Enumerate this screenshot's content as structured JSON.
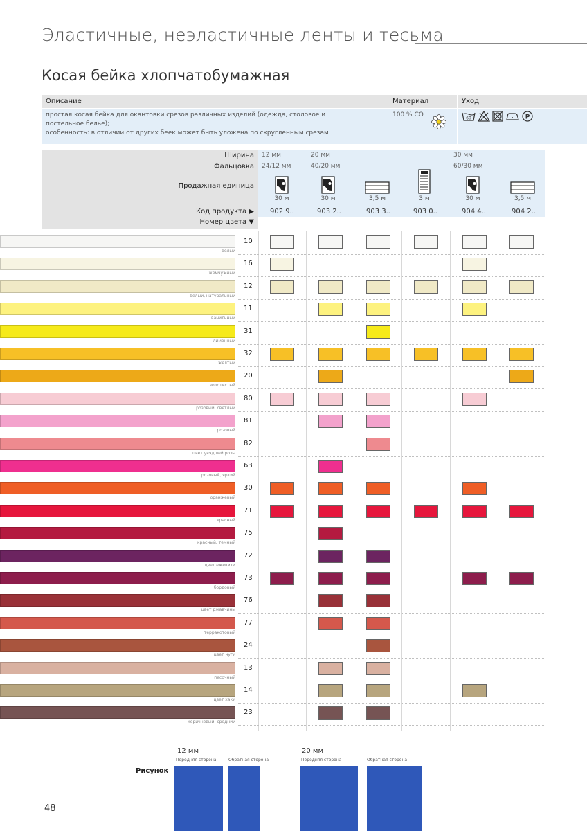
{
  "page": {
    "title": "Эластичные, неэластичные ленты и тесьма",
    "section": "Косая бейка хлопчатобумажная",
    "page_number": "48"
  },
  "info": {
    "desc_header": "Описание",
    "material_header": "Материал",
    "care_header": "Уход",
    "description_lines": [
      "простая косая бейка для окантовки срезов различных изделий (одежда, столовое и",
      "постельное белье);",
      "особенность: в отличии от других беек может быть уложена по скругленным срезам"
    ],
    "material": "100 % СО",
    "material_icon": "daisy-icon",
    "care_icons": [
      "wash-60-icon",
      "no-bleach-icon",
      "tumble-dry-icon",
      "iron-icon",
      "dry-clean-p-icon"
    ]
  },
  "spec": {
    "width_label": "Ширина",
    "fold_label": "Фальцовка",
    "unit_label": "Продажная единица",
    "code_label": "Код продукта ▶",
    "color_label": "Номер цвета ▼",
    "widths": [
      "12 мм",
      "20 мм",
      "30 мм"
    ],
    "folds": [
      "24/12 мм",
      "40/20 мм",
      "60/30 мм"
    ],
    "products": [
      {
        "unit_icon": "roll-icon",
        "length": "30 м",
        "code": "902 9.."
      },
      {
        "unit_icon": "roll-icon",
        "length": "30 м",
        "code": "903 2.."
      },
      {
        "unit_icon": "card-icon",
        "length": "3,5 м",
        "code": "903 3.."
      },
      {
        "unit_icon": "pack-icon",
        "length": "3 м",
        "code": "903 0.."
      },
      {
        "unit_icon": "roll-icon",
        "length": "30 м",
        "code": "904 4.."
      },
      {
        "unit_icon": "card-icon",
        "length": "3,5 м",
        "code": "904 2.."
      }
    ]
  },
  "colors": [
    {
      "num": "10",
      "name": "белый",
      "hex": "#f6f6f4",
      "avail": [
        1,
        1,
        1,
        1,
        1,
        1
      ]
    },
    {
      "num": "16",
      "name": "жемчужный",
      "hex": "#f7f4e2",
      "avail": [
        1,
        0,
        0,
        0,
        1,
        0
      ]
    },
    {
      "num": "12",
      "name": "белый, натуральный",
      "hex": "#f0e9c6",
      "avail": [
        1,
        1,
        1,
        1,
        1,
        1
      ]
    },
    {
      "num": "11",
      "name": "ванильный",
      "hex": "#fdf27f",
      "avail": [
        0,
        1,
        1,
        0,
        1,
        0
      ]
    },
    {
      "num": "31",
      "name": "лимонный",
      "hex": "#f6ea1a",
      "avail": [
        0,
        0,
        1,
        0,
        0,
        0
      ]
    },
    {
      "num": "32",
      "name": "желтый",
      "hex": "#f7c026",
      "avail": [
        1,
        1,
        1,
        1,
        1,
        1
      ]
    },
    {
      "num": "20",
      "name": "золотистый",
      "hex": "#eda918",
      "avail": [
        0,
        1,
        0,
        0,
        0,
        1
      ]
    },
    {
      "num": "80",
      "name": "розовый, светлый",
      "hex": "#f7ccd4",
      "avail": [
        1,
        1,
        1,
        0,
        1,
        0
      ]
    },
    {
      "num": "81",
      "name": "розовый",
      "hex": "#f3a2cc",
      "avail": [
        0,
        1,
        1,
        0,
        0,
        0
      ]
    },
    {
      "num": "82",
      "name": "цвет увядшей розы",
      "hex": "#ee8a8f",
      "avail": [
        0,
        0,
        1,
        0,
        0,
        0
      ]
    },
    {
      "num": "63",
      "name": "розовый, яркий",
      "hex": "#ef2f8f",
      "avail": [
        0,
        1,
        0,
        0,
        0,
        0
      ]
    },
    {
      "num": "30",
      "name": "оранжевый",
      "hex": "#ef5e26",
      "avail": [
        1,
        1,
        1,
        0,
        1,
        0
      ]
    },
    {
      "num": "71",
      "name": "красный",
      "hex": "#e6163c",
      "avail": [
        1,
        1,
        1,
        1,
        1,
        1
      ]
    },
    {
      "num": "75",
      "name": "красный, темный",
      "hex": "#b41a40",
      "avail": [
        0,
        1,
        0,
        0,
        0,
        0
      ]
    },
    {
      "num": "72",
      "name": "цвет ежевики",
      "hex": "#6c2460",
      "avail": [
        0,
        1,
        1,
        0,
        0,
        0
      ]
    },
    {
      "num": "73",
      "name": "бордовый",
      "hex": "#8d1d4c",
      "avail": [
        1,
        1,
        1,
        0,
        1,
        1
      ]
    },
    {
      "num": "76",
      "name": "цвет ржавчины",
      "hex": "#993138",
      "avail": [
        0,
        1,
        1,
        0,
        0,
        0
      ]
    },
    {
      "num": "77",
      "name": "терракотовый",
      "hex": "#d4584c",
      "avail": [
        0,
        1,
        1,
        0,
        0,
        0
      ]
    },
    {
      "num": "24",
      "name": "цвет нуги",
      "hex": "#a9553e",
      "avail": [
        0,
        0,
        1,
        0,
        0,
        0
      ]
    },
    {
      "num": "13",
      "name": "песочный",
      "hex": "#d9b1a1",
      "avail": [
        0,
        1,
        1,
        0,
        0,
        0
      ]
    },
    {
      "num": "14",
      "name": "цвет хаки",
      "hex": "#b7a57e",
      "avail": [
        0,
        1,
        1,
        0,
        1,
        0
      ]
    },
    {
      "num": "23",
      "name": "коричневый, средний",
      "hex": "#765454",
      "avail": [
        0,
        1,
        1,
        0,
        0,
        0
      ]
    }
  ],
  "figure": {
    "label": "Рисунок",
    "width_12": "12 мм",
    "width_20": "20 мм",
    "front": "Передняя сторона",
    "back": "Обратная сторона",
    "sample_color": "#2f58b9"
  }
}
